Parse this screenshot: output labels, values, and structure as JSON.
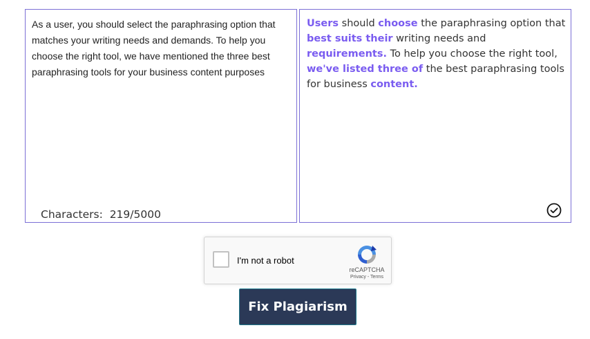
{
  "input": {
    "text": "As a user, you should select the paraphrasing option that matches your writing needs and demands. To help you choose the right tool, we have mentioned the three best paraphrasing tools for your business content purposes",
    "char_count_label": "Characters:",
    "char_count_value": "219/5000"
  },
  "output": {
    "segments": [
      {
        "text": "Users",
        "highlight": true
      },
      {
        "text": " should ",
        "highlight": false
      },
      {
        "text": "choose",
        "highlight": true
      },
      {
        "text": " the paraphrasing option that ",
        "highlight": false
      },
      {
        "text": "best suits their",
        "highlight": true
      },
      {
        "text": " writing needs and ",
        "highlight": false
      },
      {
        "text": "requirements.",
        "highlight": true
      },
      {
        "text": " To help you choose the right tool, ",
        "highlight": false
      },
      {
        "text": "we've listed three of",
        "highlight": true
      },
      {
        "text": " the best paraphrasing tools for business ",
        "highlight": false
      },
      {
        "text": "content.",
        "highlight": true
      }
    ],
    "status_icon": "check-circle-icon"
  },
  "recaptcha": {
    "label": "I'm not a robot",
    "brand": "reCAPTCHA",
    "links": "Privacy - Terms",
    "checked": false
  },
  "action": {
    "button_label": "Fix Plagiarism"
  },
  "colors": {
    "border": "#7b6fd6",
    "highlight": "#7a5cf0",
    "button_bg": "#2b3957"
  }
}
